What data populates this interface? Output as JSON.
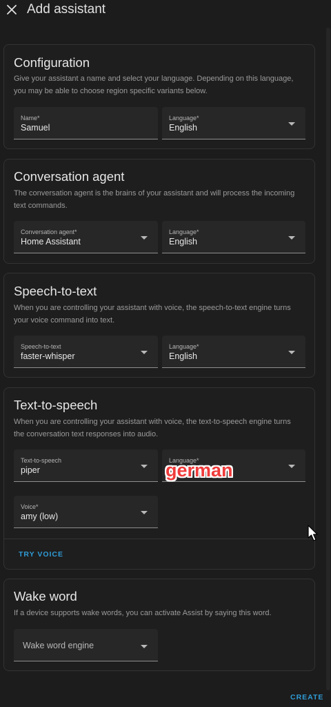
{
  "dialog": {
    "title": "Add assistant",
    "create_label": "CREATE"
  },
  "configuration": {
    "title": "Configuration",
    "description": "Give your assistant a name and select your language. Depending on this language, you may be able to choose region specific variants below.",
    "name": {
      "label": "Name*",
      "value": "Samuel"
    },
    "language": {
      "label": "Language*",
      "value": "English"
    }
  },
  "conversation_agent": {
    "title": "Conversation agent",
    "description": "The conversation agent is the brains of your assistant and will process the incoming text commands.",
    "agent": {
      "label": "Conversation agent*",
      "value": "Home Assistant"
    },
    "language": {
      "label": "Language*",
      "value": "English"
    }
  },
  "speech_to_text": {
    "title": "Speech-to-text",
    "description": "When you are controlling your assistant with voice, the speech-to-text engine turns your voice command into text.",
    "engine": {
      "label": "Speech-to-text",
      "value": "faster-whisper"
    },
    "language": {
      "label": "Language*",
      "value": "English"
    }
  },
  "text_to_speech": {
    "title": "Text-to-speech",
    "description": "When you are controlling your assistant with voice, the text-to-speech engine turns the conversation text responses into audio.",
    "engine": {
      "label": "Text-to-speech",
      "value": "piper"
    },
    "language": {
      "label": "Language*",
      "value": ""
    },
    "voice": {
      "label": "Voice*",
      "value": "amy (low)"
    },
    "try_voice_label": "TRY VOICE"
  },
  "wake_word": {
    "title": "Wake word",
    "description": "If a device supports wake words, you can activate Assist by saying this word.",
    "engine": {
      "placeholder": "Wake word engine"
    }
  },
  "annotation": {
    "text": "german"
  },
  "icons": {
    "close": "close-icon",
    "dropdown": "chevron-down-icon",
    "cursor": "mouse-pointer-icon"
  },
  "colors": {
    "accent": "#2f9bd6",
    "annotation": "#f03b3b",
    "background": "#1c1c1c",
    "field": "#272727"
  }
}
